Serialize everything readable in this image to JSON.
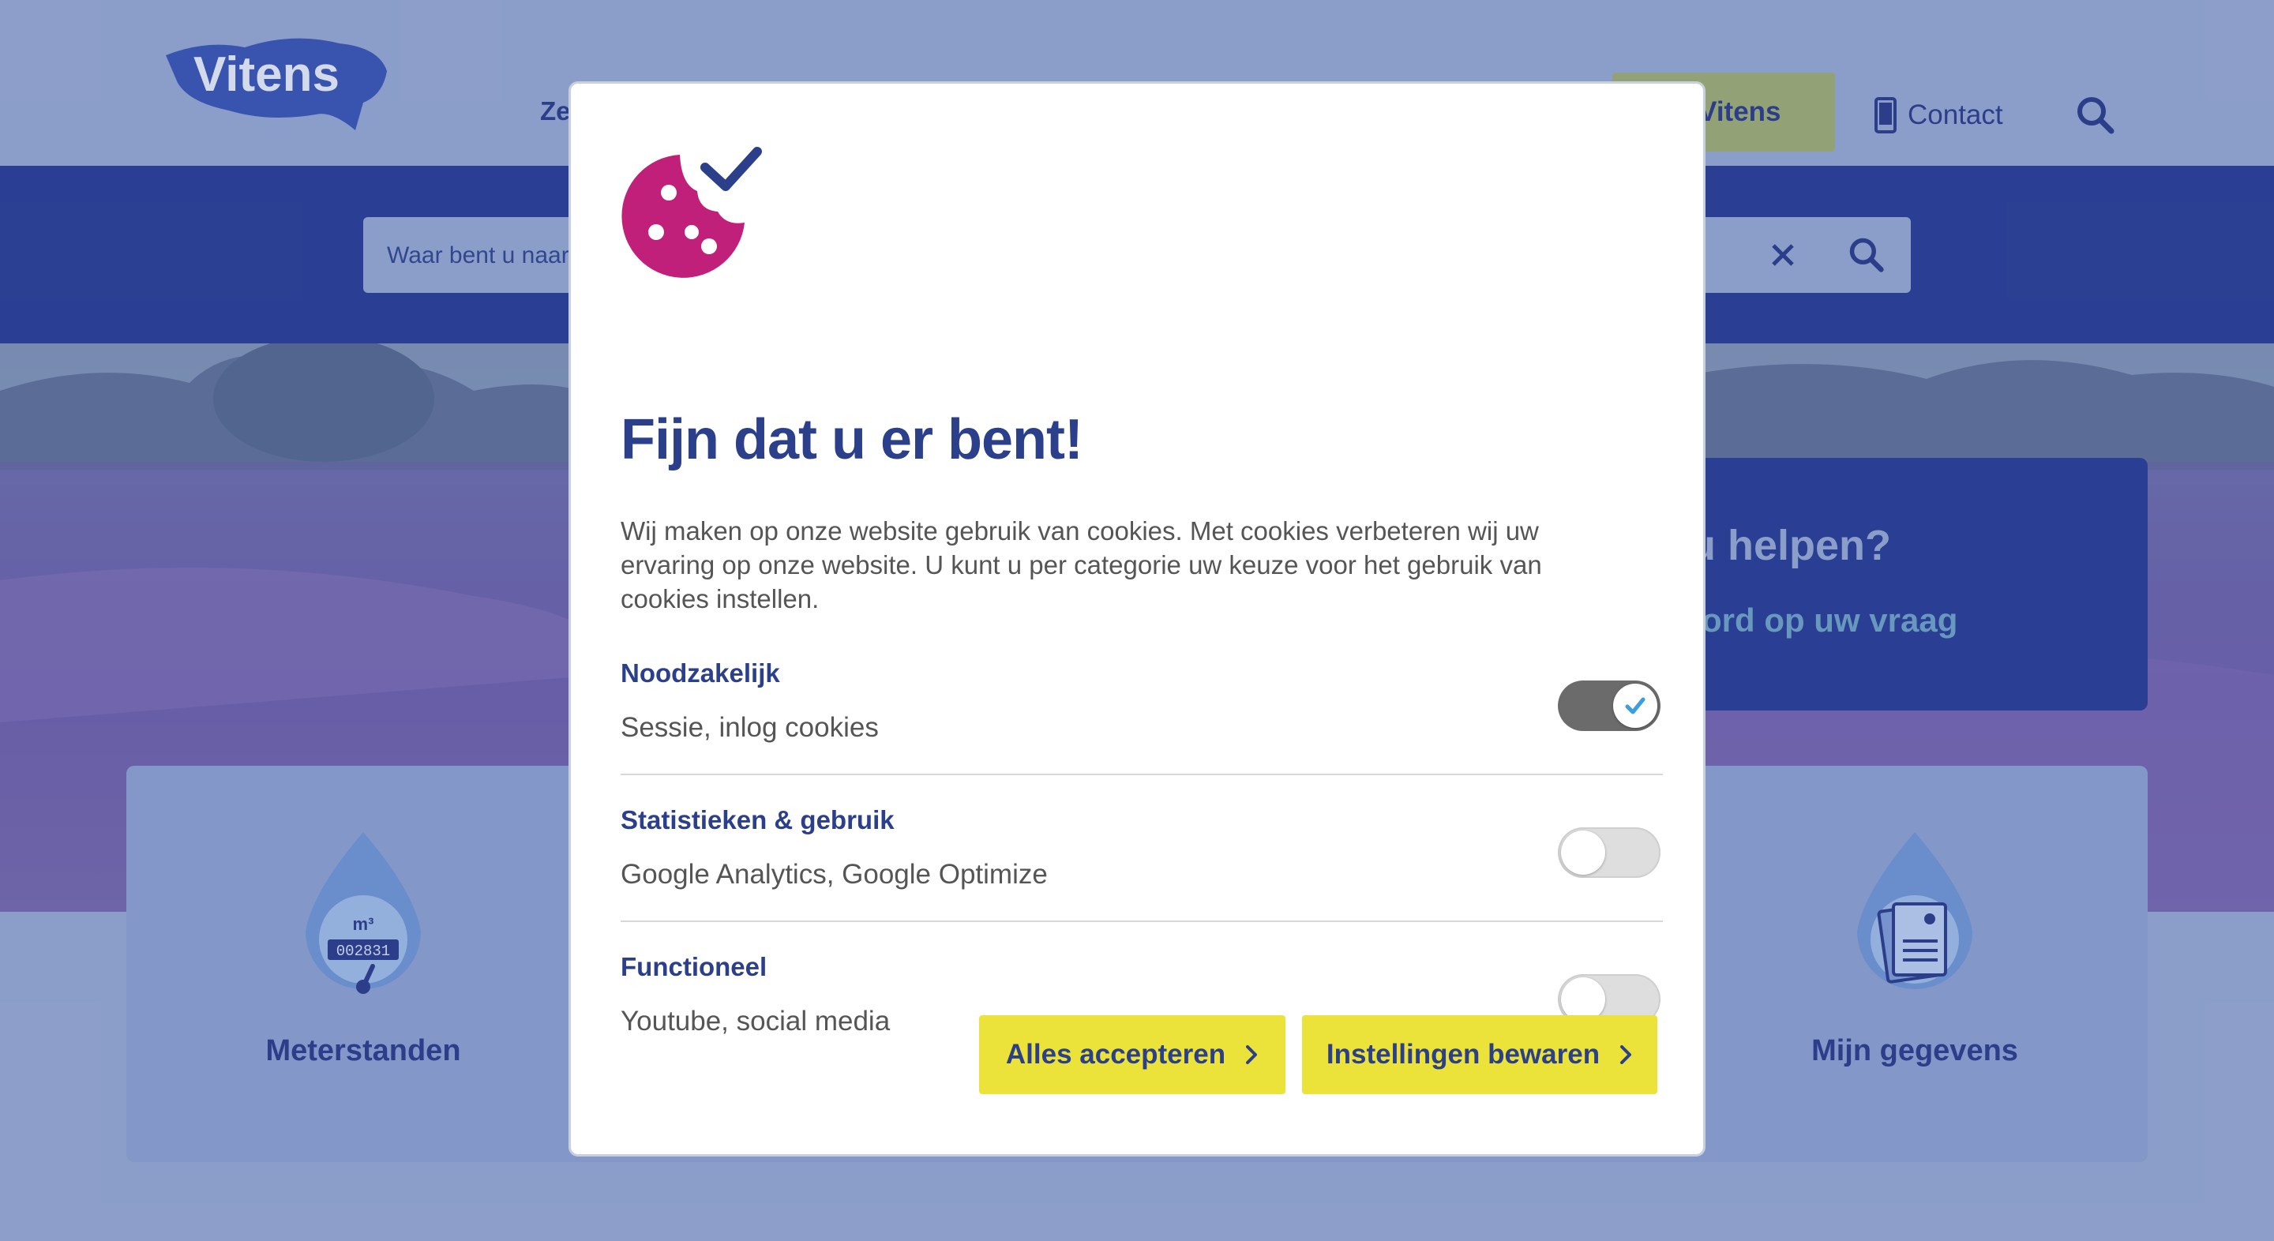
{
  "header": {
    "logo_text": "Vitens",
    "nav_partial": "Ze",
    "mijn_vitens_partial": "n Vitens",
    "contact_label": "Contact"
  },
  "search": {
    "placeholder": "Waar bent u naar"
  },
  "hero": {
    "help_title_partial": "u helpen?",
    "help_link_partial": "ord op uw vraag"
  },
  "tiles": [
    {
      "label": "Meterstanden",
      "meter_unit": "m³",
      "meter_digits": "002831"
    },
    {
      "label": "Mijn gegevens"
    }
  ],
  "dialog": {
    "title": "Fijn dat u er bent!",
    "intro": "Wij maken op onze website gebruik van cookies. Met cookies verbeteren wij uw ervaring op onze website. U kunt u per categorie uw keuze voor het gebruik van cookies instellen.",
    "categories": [
      {
        "name": "Noodzakelijk",
        "description": "Sessie, inlog cookies",
        "enabled": true
      },
      {
        "name": "Statistieken & gebruik",
        "description": "Google Analytics, Google Optimize",
        "enabled": false
      },
      {
        "name": "Functioneel",
        "description": "Youtube, social media",
        "enabled": false
      }
    ],
    "accept_all_label": "Alles accepteren",
    "save_settings_label": "Instellingen bewaren"
  },
  "colors": {
    "brand_blue": "#2b3f8a",
    "accent_magenta": "#c0207a",
    "button_yellow": "#ece33a",
    "toggle_on": "#6b6b6b"
  }
}
